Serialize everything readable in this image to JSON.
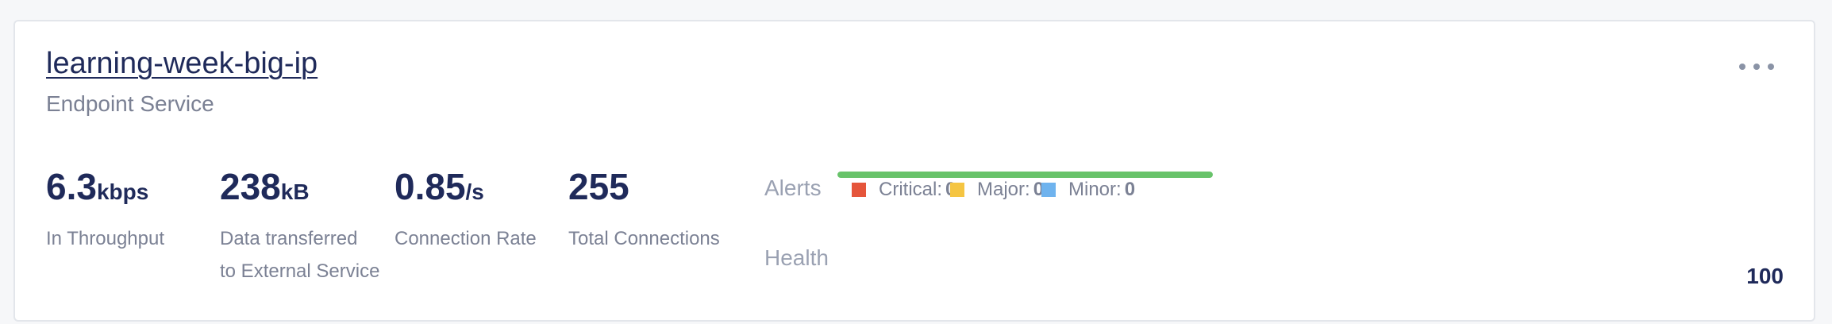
{
  "card": {
    "title": "learning-week-big-ip",
    "subtitle": "Endpoint Service",
    "menu_icon": "more-horizontal-icon"
  },
  "metrics": [
    {
      "value": "6.3",
      "unit": "kbps",
      "label_line1": "In Throughput",
      "label_line2": ""
    },
    {
      "value": "238",
      "unit": "kB",
      "label_line1": "Data transferred",
      "label_line2": "to External Service"
    },
    {
      "value": "0.85",
      "unit": "/s",
      "label_line1": "Connection Rate",
      "label_line2": ""
    },
    {
      "value": "255",
      "unit": "",
      "label_line1": "Total Connections",
      "label_line2": ""
    }
  ],
  "alerts": {
    "label": "Alerts",
    "items": [
      {
        "name": "Critical",
        "count": "0",
        "color": "#e5553b"
      },
      {
        "name": "Major",
        "count": "0",
        "color": "#f5c542"
      },
      {
        "name": "Minor",
        "count": "0",
        "color": "#6fb3ee"
      }
    ]
  },
  "health": {
    "label": "Health",
    "value": "100",
    "fraction": 1.0,
    "color": "#68c36a"
  }
}
